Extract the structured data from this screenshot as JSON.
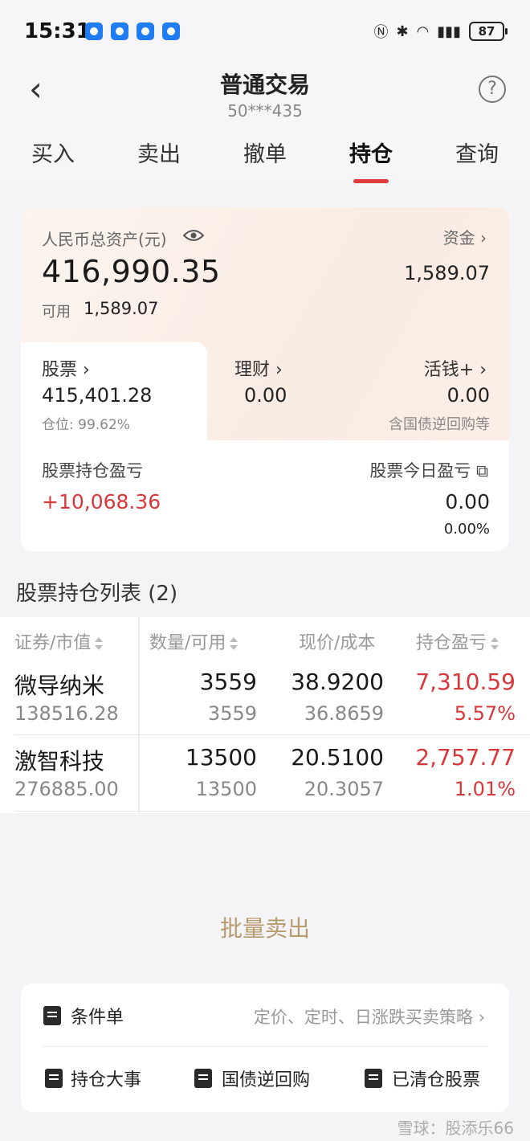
{
  "status_bar": {
    "time": "15:31",
    "battery": "87"
  },
  "header": {
    "title": "普通交易",
    "account": "50***435",
    "tabs": [
      "买入",
      "卖出",
      "撤单",
      "持仓",
      "查询"
    ],
    "active_tab": "持仓"
  },
  "assets": {
    "total_label": "人民币总资产(元)",
    "total_value": "416,990.35",
    "available_label": "可用",
    "available_value": "1,589.07",
    "funds_label": "资金 ›",
    "funds_value": "1,589.07",
    "stock_label": "股票 ›",
    "stock_value": "415,401.28",
    "position_ratio": "仓位:  99.62%",
    "finance_label": "理财 ›",
    "finance_value": "0.00",
    "cash_plus_label": "活钱+ ›",
    "cash_plus_value": "0.00",
    "cash_plus_note": "含国债逆回购等",
    "holding_pl_label": "股票持仓盈亏",
    "holding_pl_value": "+10,068.36",
    "today_pl_label": "股票今日盈亏",
    "today_pl_value": "0.00",
    "today_pl_pct": "0.00%"
  },
  "holdings": {
    "title": "股票持仓列表 (2)",
    "columns": [
      "证券/市值",
      "数量/可用",
      "现价/成本",
      "持仓盈亏"
    ],
    "rows": [
      {
        "name": "微导纳米",
        "market_value": "138516.28",
        "qty": "3559",
        "avail": "3559",
        "price": "38.9200",
        "cost": "36.8659",
        "pl": "7,310.59",
        "pl_pct": "5.57%"
      },
      {
        "name": "激智科技",
        "market_value": "276885.00",
        "qty": "13500",
        "avail": "13500",
        "price": "20.5100",
        "cost": "20.3057",
        "pl": "2,757.77",
        "pl_pct": "1.01%"
      }
    ]
  },
  "batch_sell": "批量卖出",
  "tools": {
    "conditional_label": "条件单",
    "conditional_desc": "定价、定时、日涨跌买卖策略 ›",
    "events_label": "持仓大事",
    "repo_label": "国债逆回购",
    "cleared_label": "已清仓股票"
  },
  "watermark": "雪球：股添乐66",
  "colors": {
    "red": "#d8383a",
    "tab_indicator": "#e03b3b",
    "batch_sell": "#b89a6c"
  }
}
